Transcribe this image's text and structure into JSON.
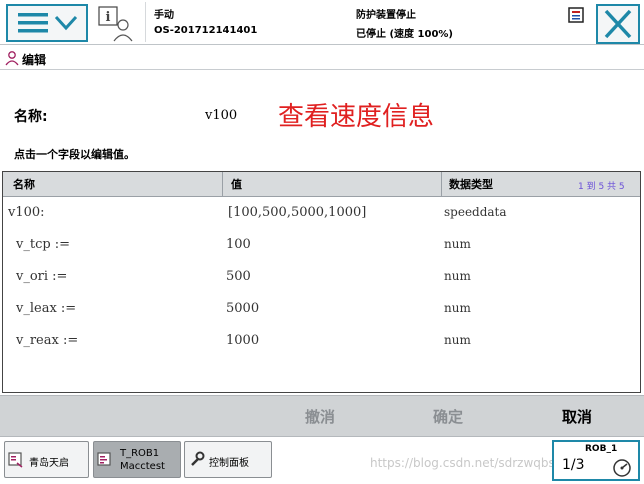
{
  "top": {
    "mode_label": "手动",
    "controller": "OS-201712141401",
    "guard_status": "防护装置停止",
    "run_status": "已停止 (速度 100%)"
  },
  "edit": {
    "header": "编辑",
    "name_label": "名称:",
    "name_value": "v100",
    "overlay_title": "查看速度信息",
    "instruction": "点击一个字段以编辑值。"
  },
  "table": {
    "headers": [
      "名称",
      "值",
      "数据类型"
    ],
    "pager": "1 到 5 共 5",
    "rows": [
      {
        "name": "v100:",
        "value": "[100,500,5000,1000]",
        "type": "speeddata"
      },
      {
        "name": "v_tcp :=",
        "value": "100",
        "type": "num"
      },
      {
        "name": "v_ori :=",
        "value": "500",
        "type": "num"
      },
      {
        "name": "v_leax :=",
        "value": "5000",
        "type": "num"
      },
      {
        "name": "v_reax :=",
        "value": "1000",
        "type": "num"
      }
    ]
  },
  "actions": {
    "undo": "撤消",
    "ok": "确定",
    "cancel": "取消"
  },
  "taskbar": {
    "task1": "青岛天启",
    "task2_line1": "T_ROB1",
    "task2_line2": "Macctest",
    "task3": "控制面板",
    "rob_label": "ROB_1",
    "rob_fraction": "1/3"
  },
  "watermark": "https://blog.csdn.net/sdrzwqbsdr"
}
